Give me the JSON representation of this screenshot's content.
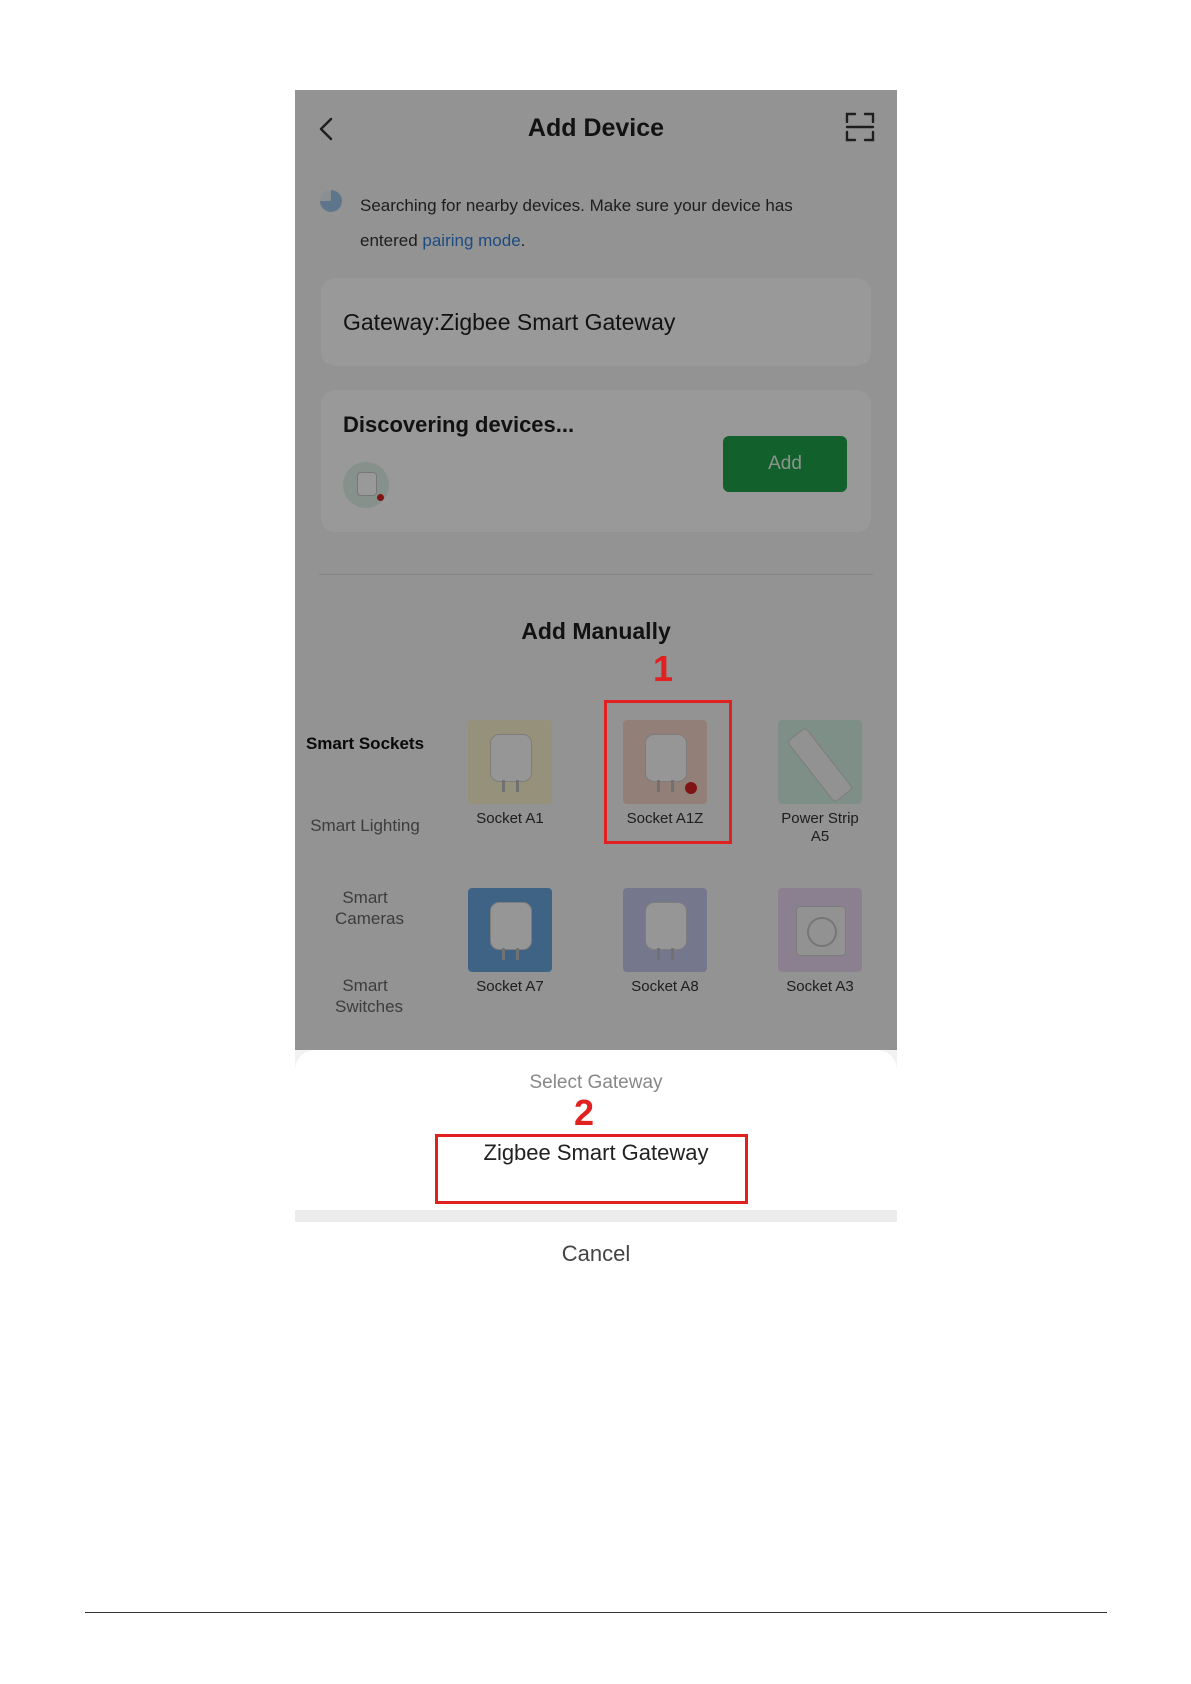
{
  "header": {
    "title": "Add Device"
  },
  "search": {
    "text_before": "Searching for nearby devices. Make sure your device has entered ",
    "link": "pairing mode",
    "text_after": "."
  },
  "gateway_card": {
    "label": "Gateway:Zigbee Smart Gateway"
  },
  "discover_card": {
    "title": "Discovering devices...",
    "add_label": "Add",
    "add_color": "#1ea14a"
  },
  "manual": {
    "title": "Add Manually",
    "categories": [
      "Smart Sockets",
      "Smart Lighting",
      "Smart Cameras",
      "Smart Switches"
    ],
    "devices": [
      {
        "label": "Socket A1",
        "bg": "#fbf2cc"
      },
      {
        "label": "Socket A1Z",
        "bg": "#f3d6c8"
      },
      {
        "label": "Power Strip A5",
        "bg": "#d2eee2"
      },
      {
        "label": "Socket A7",
        "bg": "#6aa6dc"
      },
      {
        "label": "Socket A8",
        "bg": "#c3c9ec"
      },
      {
        "label": "Socket A3",
        "bg": "#e6d6f0"
      }
    ]
  },
  "sheet": {
    "title": "Select Gateway",
    "option": "Zigbee Smart Gateway",
    "cancel": "Cancel"
  },
  "annotations": {
    "step1": "1",
    "step2": "2",
    "highlight_color": "#e0211f"
  }
}
